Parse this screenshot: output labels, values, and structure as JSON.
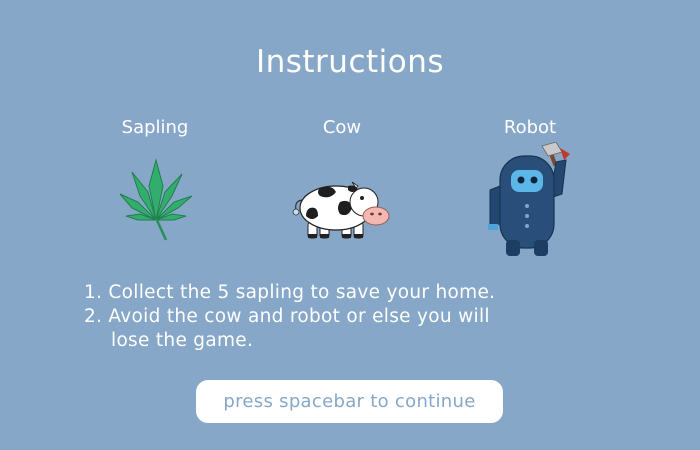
{
  "screen": {
    "title": "Instructions"
  },
  "characters": [
    {
      "label": "Sapling",
      "icon": "sapling-leaf-icon"
    },
    {
      "label": "Cow",
      "icon": "cow-icon"
    },
    {
      "label": "Robot",
      "icon": "robot-with-axe-icon"
    }
  ],
  "instructions": {
    "line1": "1.  Collect the 5 sapling to save your home.",
    "line2": "2. Avoid the cow and robot or else you will",
    "line3": "lose the game."
  },
  "continue_button": {
    "label": "press spacebar to continue"
  },
  "colors": {
    "background": "#86a7c8",
    "text": "#ffffff",
    "leaf": "#2ea86a",
    "robot": "#24476f",
    "robot_face": "#5bb7e8"
  }
}
